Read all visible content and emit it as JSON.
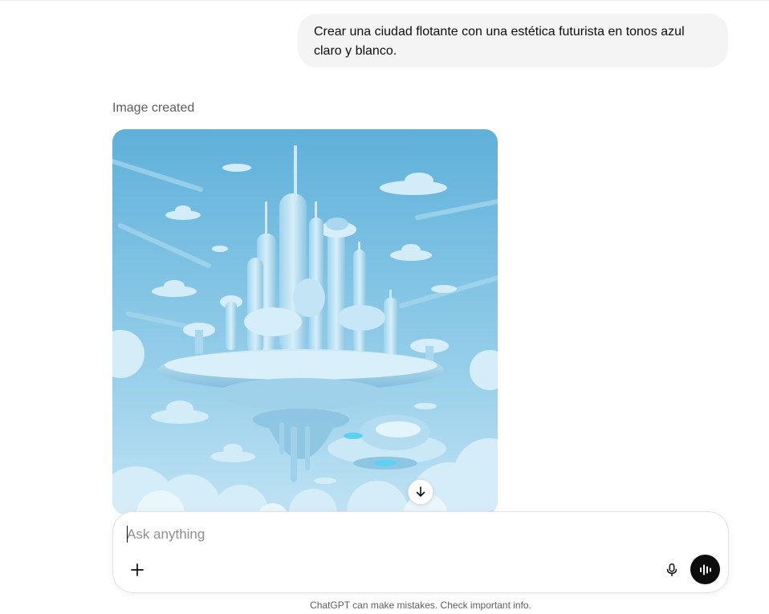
{
  "conversation": {
    "user_message": "Crear una ciudad flotante con una estética futurista en tonos azul claro y blanco.",
    "assistant": {
      "image_label": "Image created",
      "image_alt": "floating futuristic city illustration"
    }
  },
  "composer": {
    "placeholder": "Ask anything",
    "value": ""
  },
  "icons": {
    "scroll": "arrow-down-icon",
    "attach": "plus-icon",
    "dictate": "microphone-icon",
    "voice": "voice-mode-icon"
  },
  "footer": {
    "disclaimer": "ChatGPT can make mistakes. Check important info."
  },
  "colors": {
    "bubble_bg": "#f4f4f4",
    "voice_button": "#0d0d0d",
    "sky": "#6ab6db",
    "city": "#b8e0f2"
  }
}
